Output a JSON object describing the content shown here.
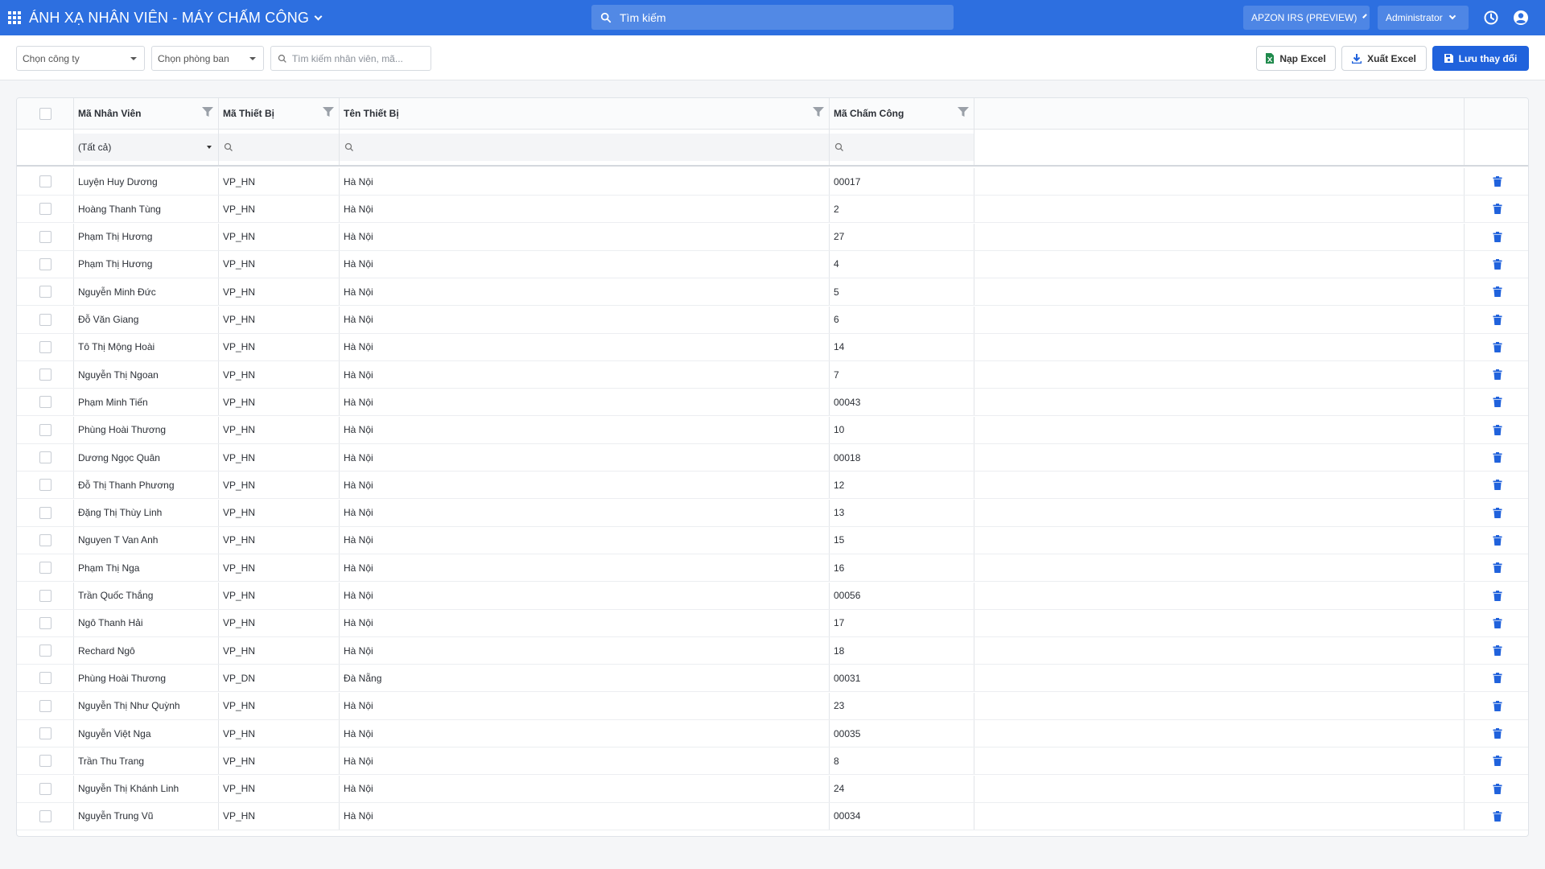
{
  "header": {
    "title": "ÁNH XẠ NHÂN VIÊN - MÁY CHẤM CÔNG",
    "search_placeholder": "Tìm kiếm",
    "tenant": "APZON IRS (PREVIEW)",
    "user": "Administrator",
    "accent": "#2d6fe0"
  },
  "toolbar": {
    "company_placeholder": "Chọn công ty",
    "department_placeholder": "Chọn phòng ban",
    "search_placeholder": "Tìm kiếm nhân viên, mã...",
    "import_label": "Nạp Excel",
    "export_label": "Xuất Excel",
    "save_label": "Lưu thay đổi",
    "save_color": "#2062dc"
  },
  "grid": {
    "columns": [
      "Mã Nhân Viên",
      "Mã Thiết Bị",
      "Tên Thiết Bị",
      "Mã Chấm Công"
    ],
    "filter_all": "(Tất cả)",
    "rows": [
      {
        "employee": "Luyện Huy Dương",
        "device_code": "VP_HN",
        "device_name": "Hà Nội",
        "timekeeping_code": "00017"
      },
      {
        "employee": "Hoàng Thanh Tùng",
        "device_code": "VP_HN",
        "device_name": "Hà Nội",
        "timekeeping_code": "2"
      },
      {
        "employee": "Phạm Thị Hương",
        "device_code": "VP_HN",
        "device_name": "Hà Nội",
        "timekeeping_code": "27"
      },
      {
        "employee": "Phạm Thị Hương",
        "device_code": "VP_HN",
        "device_name": "Hà Nội",
        "timekeeping_code": "4"
      },
      {
        "employee": "Nguyễn Minh Đức",
        "device_code": "VP_HN",
        "device_name": "Hà Nội",
        "timekeeping_code": "5"
      },
      {
        "employee": "Đỗ Văn Giang",
        "device_code": "VP_HN",
        "device_name": "Hà Nội",
        "timekeeping_code": "6"
      },
      {
        "employee": "Tô Thị Mộng Hoài",
        "device_code": "VP_HN",
        "device_name": "Hà Nội",
        "timekeeping_code": "14"
      },
      {
        "employee": "Nguyễn Thị Ngoan",
        "device_code": "VP_HN",
        "device_name": "Hà Nội",
        "timekeeping_code": "7"
      },
      {
        "employee": "Phạm Minh Tiến",
        "device_code": "VP_HN",
        "device_name": "Hà Nội",
        "timekeeping_code": "00043"
      },
      {
        "employee": "Phùng Hoài Thương",
        "device_code": "VP_HN",
        "device_name": "Hà Nội",
        "timekeeping_code": "10"
      },
      {
        "employee": "Dương Ngọc Quân",
        "device_code": "VP_HN",
        "device_name": "Hà Nội",
        "timekeeping_code": "00018"
      },
      {
        "employee": "Đỗ Thị Thanh Phương",
        "device_code": "VP_HN",
        "device_name": "Hà Nội",
        "timekeeping_code": "12"
      },
      {
        "employee": "Đặng Thị Thùy Linh",
        "device_code": "VP_HN",
        "device_name": "Hà Nội",
        "timekeeping_code": "13"
      },
      {
        "employee": "Nguyen T Van Anh",
        "device_code": "VP_HN",
        "device_name": "Hà Nội",
        "timekeeping_code": "15"
      },
      {
        "employee": "Phạm Thị Nga",
        "device_code": "VP_HN",
        "device_name": "Hà Nội",
        "timekeeping_code": "16"
      },
      {
        "employee": "Trần Quốc Thắng",
        "device_code": "VP_HN",
        "device_name": "Hà Nội",
        "timekeeping_code": "00056"
      },
      {
        "employee": "Ngô Thanh Hải",
        "device_code": "VP_HN",
        "device_name": "Hà Nội",
        "timekeeping_code": "17"
      },
      {
        "employee": "Rechard Ngô",
        "device_code": "VP_HN",
        "device_name": "Hà Nội",
        "timekeeping_code": "18"
      },
      {
        "employee": "Phùng Hoài Thương",
        "device_code": "VP_DN",
        "device_name": "Đà Nẵng",
        "timekeeping_code": "00031"
      },
      {
        "employee": "Nguyễn Thị Như Quỳnh",
        "device_code": "VP_HN",
        "device_name": "Hà Nội",
        "timekeeping_code": "23"
      },
      {
        "employee": "Nguyễn Việt Nga",
        "device_code": "VP_HN",
        "device_name": "Hà Nội",
        "timekeeping_code": "00035"
      },
      {
        "employee": "Trần Thu Trang",
        "device_code": "VP_HN",
        "device_name": "Hà Nội",
        "timekeeping_code": "8"
      },
      {
        "employee": "Nguyễn Thị Khánh Linh",
        "device_code": "VP_HN",
        "device_name": "Hà Nội",
        "timekeeping_code": "24"
      },
      {
        "employee": "Nguyễn Trung Vũ",
        "device_code": "VP_HN",
        "device_name": "Hà Nội",
        "timekeeping_code": "00034"
      }
    ]
  },
  "icons": {
    "apps": "apps-grid-icon",
    "search": "search-icon",
    "history": "clock-icon",
    "account": "user-circle-icon",
    "filter": "filter-icon",
    "delete": "trash-icon",
    "import": "excel-file-icon",
    "export": "download-icon",
    "save": "floppy-disk-icon"
  }
}
